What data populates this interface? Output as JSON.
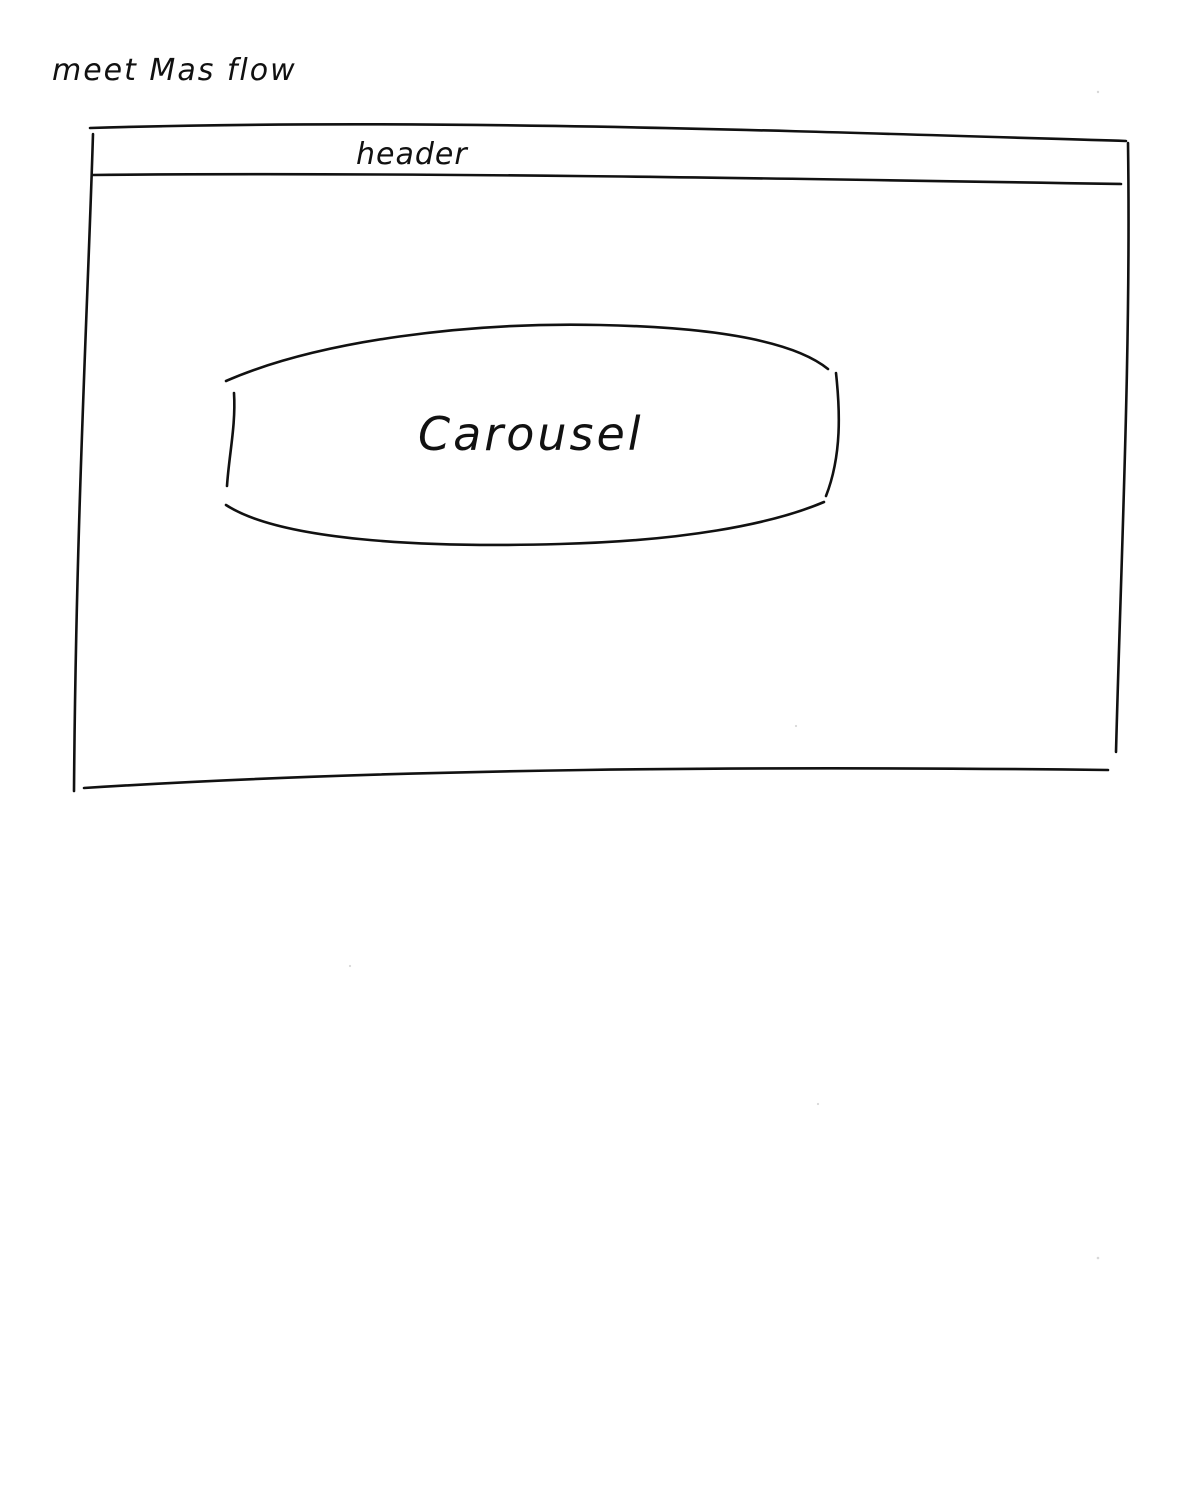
{
  "page": {
    "title": "meet Mas flow"
  },
  "wireframe": {
    "header_label": "header",
    "carousel_label": "Carousel"
  }
}
